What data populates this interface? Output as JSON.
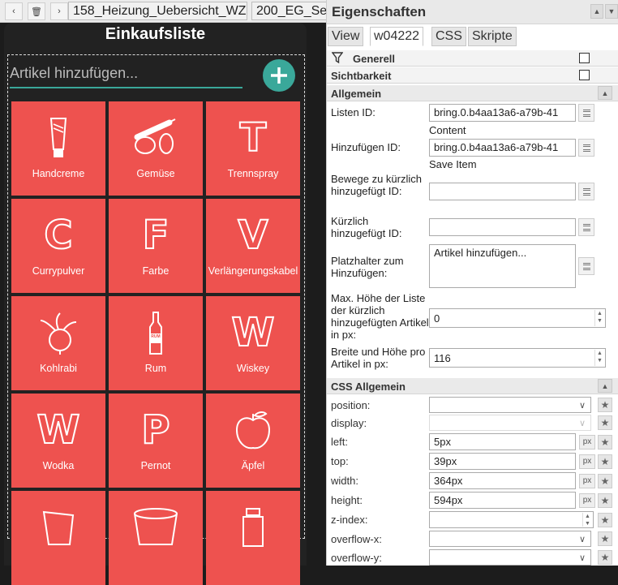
{
  "topbar": {
    "tabs": [
      "158_Heizung_Uebersicht_WZ",
      "200_EG_Se"
    ]
  },
  "widget": {
    "title": "Einkaufsliste",
    "add_placeholder": "Artikel hinzufügen...",
    "items": [
      {
        "label": "Handcreme",
        "icon": "handcream-icon"
      },
      {
        "label": "Gemüse",
        "icon": "vegetables-icon"
      },
      {
        "label": "Trennspray",
        "letter": "T"
      },
      {
        "label": "Currypulver",
        "letter": "C"
      },
      {
        "label": "Farbe",
        "letter": "F"
      },
      {
        "label": "Verlängerungskabel",
        "letter": "V"
      },
      {
        "label": "Kohlrabi",
        "icon": "kohlrabi-icon"
      },
      {
        "label": "Rum",
        "icon": "rum-bottle-icon",
        "icon_text": "RUM"
      },
      {
        "label": "Wiskey",
        "letter": "W"
      },
      {
        "label": "Wodka",
        "letter": "W"
      },
      {
        "label": "Pernot",
        "letter": "P"
      },
      {
        "label": "Äpfel",
        "icon": "apple-icon"
      },
      {
        "label": "",
        "icon": "cup-icon"
      },
      {
        "label": "",
        "icon": "bucket-icon"
      },
      {
        "label": "",
        "icon": "jar-icon"
      }
    ],
    "accent": "#ee524f",
    "teal": "#3aa89a"
  },
  "panel": {
    "title": "Eigenschaften",
    "tabs": [
      "View",
      "w04222",
      "CSS",
      "Skripte"
    ],
    "generell": "Generell",
    "sichtbarkeit": "Sichtbarkeit",
    "allgemein": "Allgemein",
    "fields": {
      "listen_id_label": "Listen ID:",
      "listen_id_value": "bring.0.b4aa13a6-a79b-41",
      "listen_id_sub": "Content",
      "hinzu_id_label": "Hinzufügen ID:",
      "hinzu_id_value": "bring.0.b4aa13a6-a79b-41",
      "hinzu_id_sub": "Save Item",
      "bewege_label": "Bewege zu kürzlich hinzugefügt ID:",
      "kurzlich_label": "Kürzlich hinzugefügt ID:",
      "platz_label": "Platzhalter zum Hinzufügen:",
      "platz_value": "Artikel hinzufügen...",
      "maxh_label": "Max. Höhe der Liste der kürzlich hinzugefügten Artikel in px:",
      "maxh_value": "0",
      "breite_label": "Breite und Höhe pro Artikel in px:",
      "breite_value": "116"
    },
    "css_allgemein": "CSS Allgemein",
    "css": {
      "position": "position:",
      "display": "display:",
      "left": "left:",
      "left_value": "5px",
      "top": "top:",
      "top_value": "39px",
      "width": "width:",
      "width_value": "364px",
      "height": "height:",
      "height_value": "594px",
      "zindex": "z-index:",
      "overflowx": "overflow-x:",
      "overflowy": "overflow-y:",
      "unit": "px"
    }
  }
}
